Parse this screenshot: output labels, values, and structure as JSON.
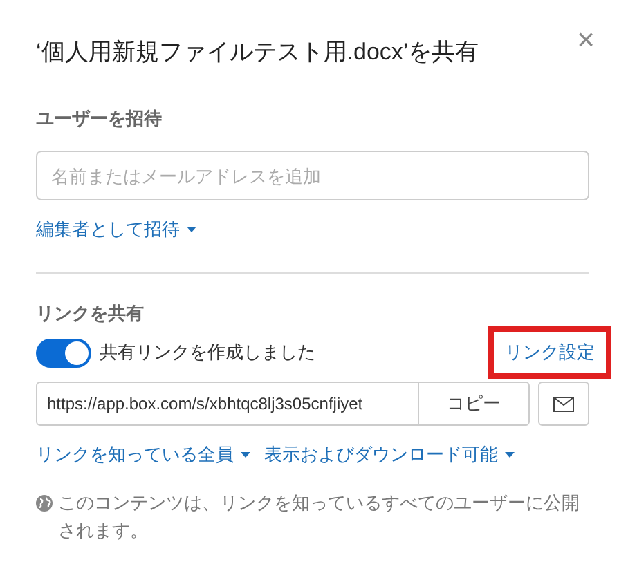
{
  "dialog": {
    "title": "‘個人用新規ファイルテスト用.docx’を共有",
    "close": "×"
  },
  "invite": {
    "heading": "ユーザーを招待",
    "placeholder": "名前またはメールアドレスを追加",
    "role": "編集者として招待"
  },
  "share_link": {
    "heading": "リンクを共有",
    "toggle_on": true,
    "toggle_label": "共有リンクを作成しました",
    "settings": "リンク設定",
    "settings_highlighted": true,
    "url": "https://app.box.com/s/xbhtqc8lj3s05cnfjiyet",
    "copy": "コピー",
    "access": "リンクを知っている全員",
    "permission": "表示およびダウンロード可能",
    "note": "このコンテンツは、リンクを知っているすべてのユーザーに公開されます。"
  }
}
